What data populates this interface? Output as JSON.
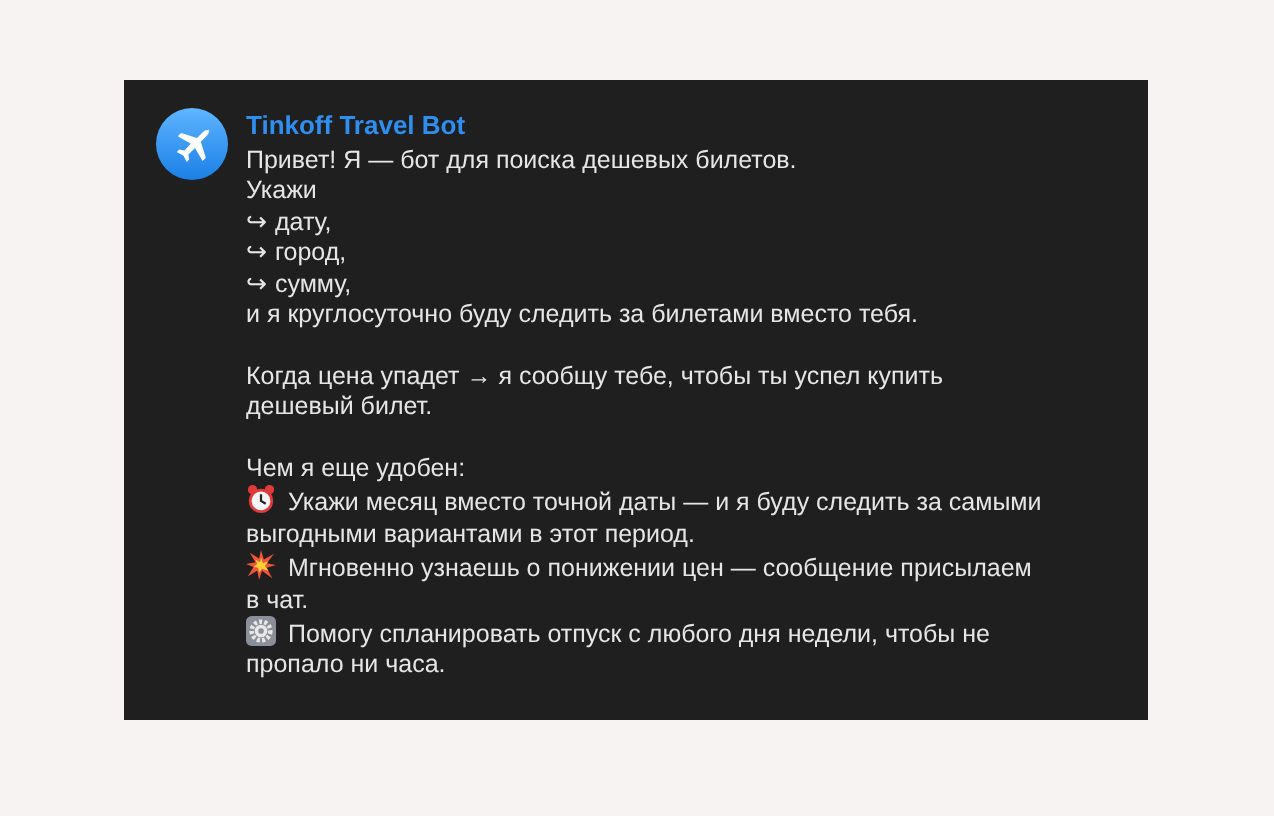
{
  "message": {
    "sender": "Tinkoff Travel Bot",
    "paragraphs": [
      {
        "lines": [
          {
            "text": "Привет! Я — бот для поиска дешевых билетов."
          },
          {
            "text": "Укажи"
          },
          {
            "text": "↪ дату,"
          },
          {
            "text": "↪ город,"
          },
          {
            "text": "↪ сумму,"
          },
          {
            "text": "и я круглосуточно буду следить за билетами вместо тебя."
          }
        ]
      },
      {
        "lines": [
          {
            "text": "Когда цена упадет → я сообщу тебе, чтобы ты успел купить дешевый билет."
          }
        ]
      },
      {
        "lines": [
          {
            "text": "Чем я еще удобен:"
          },
          {
            "text": "Укажи месяц вместо точной даты — и я буду следить за самыми выгодными вариантами в этот период.",
            "kind": "alarm"
          },
          {
            "text": "Мгновенно узнаешь о понижении цен — сообщение присылаем в чат.",
            "kind": "collision"
          },
          {
            "text": "Помогу спланировать отпуск с любого дня недели, чтобы не пропало ни часа.",
            "kind": "gear"
          }
        ]
      }
    ]
  }
}
